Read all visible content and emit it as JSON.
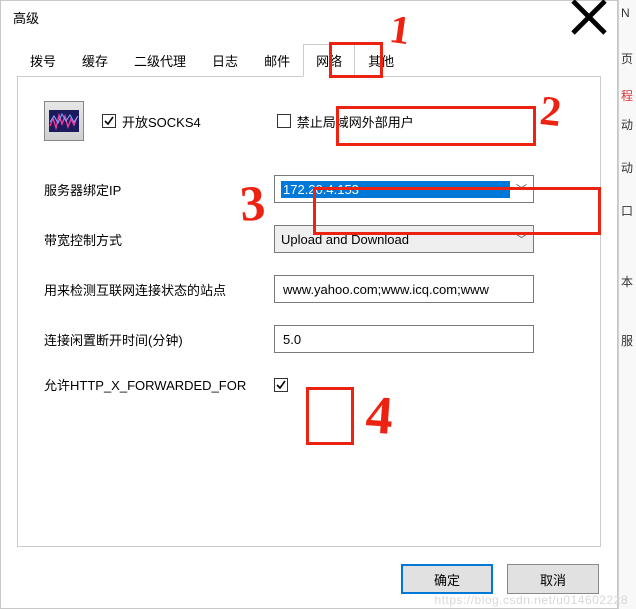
{
  "window": {
    "title": "高级"
  },
  "tabs": {
    "items": [
      {
        "label": "拨号"
      },
      {
        "label": "缓存"
      },
      {
        "label": "二级代理"
      },
      {
        "label": "日志"
      },
      {
        "label": "邮件"
      },
      {
        "label": "网络"
      },
      {
        "label": "其他"
      }
    ],
    "active_index": 5
  },
  "checkboxes": {
    "open_socks4": {
      "label": "开放SOCKS4",
      "checked": true
    },
    "forbid_external": {
      "label": "禁止局域网外部用户",
      "checked": false
    },
    "xff": {
      "checked": true
    }
  },
  "form": {
    "bind_ip_label": "服务器绑定IP",
    "bind_ip_value": "172.20.4.153",
    "bandwidth_label": "带宽控制方式",
    "bandwidth_value": "Upload and Download",
    "detect_label": "用来检测互联网连接状态的站点",
    "detect_value": "www.yahoo.com;www.icq.com;www",
    "idle_label": "连接闲置断开时间(分钟)",
    "idle_value": "5.0",
    "xff_label": "允许HTTP_X_FORWARDED_FOR"
  },
  "buttons": {
    "ok": "确定",
    "cancel": "取消"
  },
  "rightslice": {
    "a": "N",
    "b": "页",
    "c": "程",
    "d": "动",
    "e": "动",
    "f": "口",
    "g": "本",
    "h": "服"
  },
  "annotations": {
    "n1": "1",
    "n2": "2",
    "n3": "3",
    "n4": "4"
  },
  "watermark": "https://blog.csdn.net/u014602228"
}
